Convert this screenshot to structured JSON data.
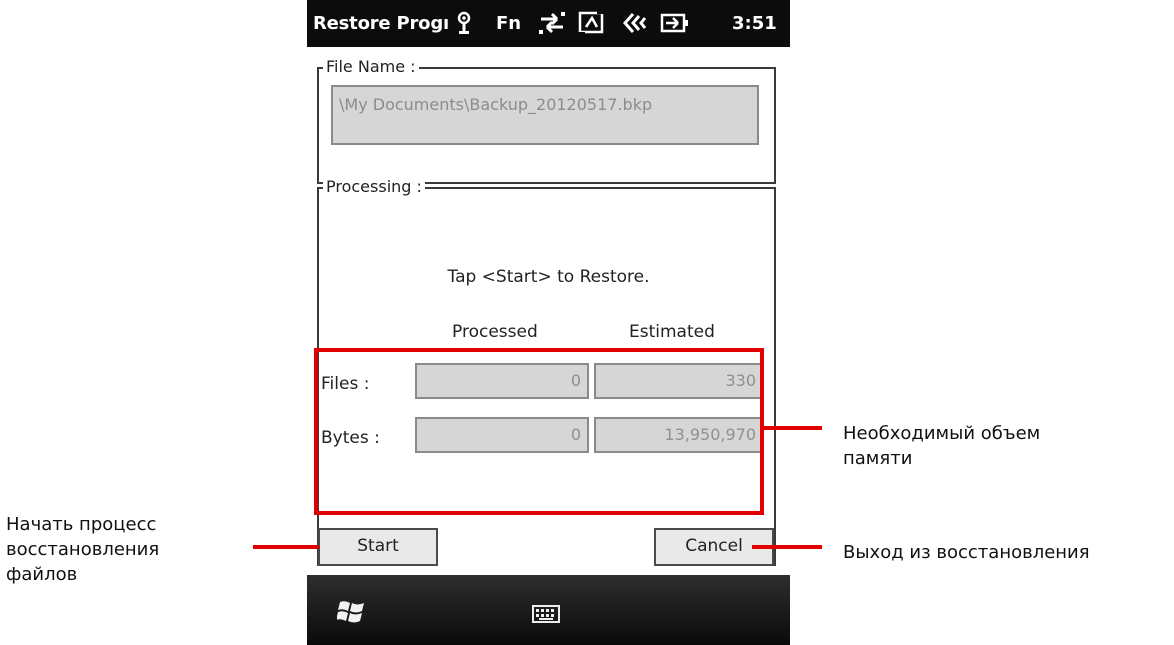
{
  "status_bar": {
    "title": "Restore Progı",
    "fn": "Fn",
    "time": "3:51",
    "icons": [
      "antenna-icon",
      "sync-arrows-icon",
      "connection-icon",
      "speaker-icon",
      "battery-plug-icon"
    ]
  },
  "file_group": {
    "label": "File Name :",
    "path": "\\My Documents\\Backup_20120517.bkp"
  },
  "processing_group": {
    "label": "Processing :",
    "message": "Tap <Start> to Restore."
  },
  "stats": {
    "col_processed": "Processed",
    "col_estimated": "Estimated",
    "rows": [
      {
        "label": "Files :",
        "processed": "0",
        "estimated": "330"
      },
      {
        "label": "Bytes :",
        "processed": "0",
        "estimated": "13,950,970"
      }
    ]
  },
  "buttons": {
    "start": "Start",
    "cancel": "Cancel"
  },
  "taskbar": {
    "icons": [
      "windows-start-icon",
      "keyboard-icon"
    ]
  },
  "annotations": {
    "memory": "Необходимый объем памяти",
    "start": "Начать процесс восстановления файлов",
    "cancel": "Выход из восстановления"
  },
  "colors": {
    "annotation_red": "#e00000",
    "statusbar_bg": "#0c0c0c"
  }
}
